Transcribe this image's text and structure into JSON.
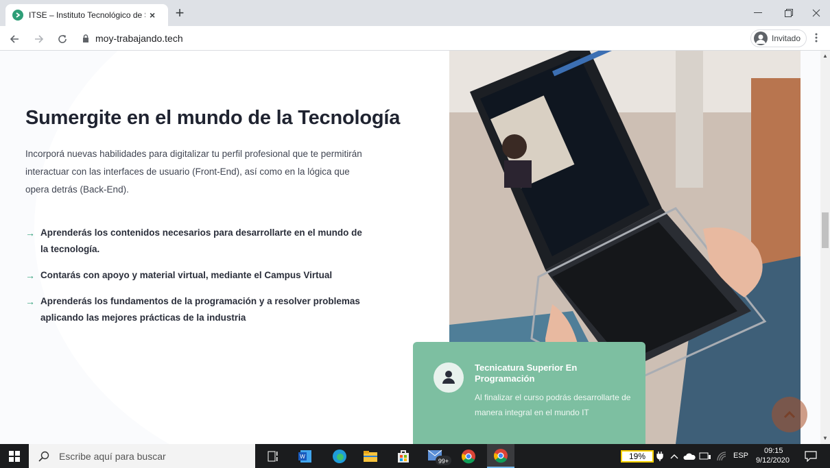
{
  "browser": {
    "tab_title": "ITSE – Instituto Tecnológico de S",
    "tab_close": "×",
    "new_tab": "+",
    "url": "moy-trabajando.tech",
    "profile_label": "Invitado"
  },
  "page": {
    "heading": "Sumergite en el mundo de la Tecnología",
    "paragraph": "Incorporá nuevas habilidades para digitalizar tu perfil profesional que te permitirán interactuar con las interfaces de usuario (Front-End), así como en la lógica que opera detrás (Back-End).",
    "bullets": [
      "Aprenderás los contenidos necesarios para desarrollarte en el mundo de la tecnología.",
      "Contarás con apoyo y material virtual, mediante el Campus Virtual",
      "Aprenderás los fundamentos de la programación y a resolver problemas aplicando las mejores prácticas de la industria"
    ],
    "card": {
      "title": "Tecnicatura Superior En Programación",
      "subtitle": "Al finalizar el curso podrás desarrollarte de manera integral en el mundo IT"
    }
  },
  "taskbar": {
    "search_placeholder": "Escribe aquí para buscar",
    "badge": "99+",
    "battery": "19%",
    "lang": "ESP",
    "time": "09:15",
    "date": "9/12/2020"
  },
  "colors": {
    "accent": "#2e9e77",
    "card": "#7dbfa1",
    "heading": "#1f2330"
  }
}
